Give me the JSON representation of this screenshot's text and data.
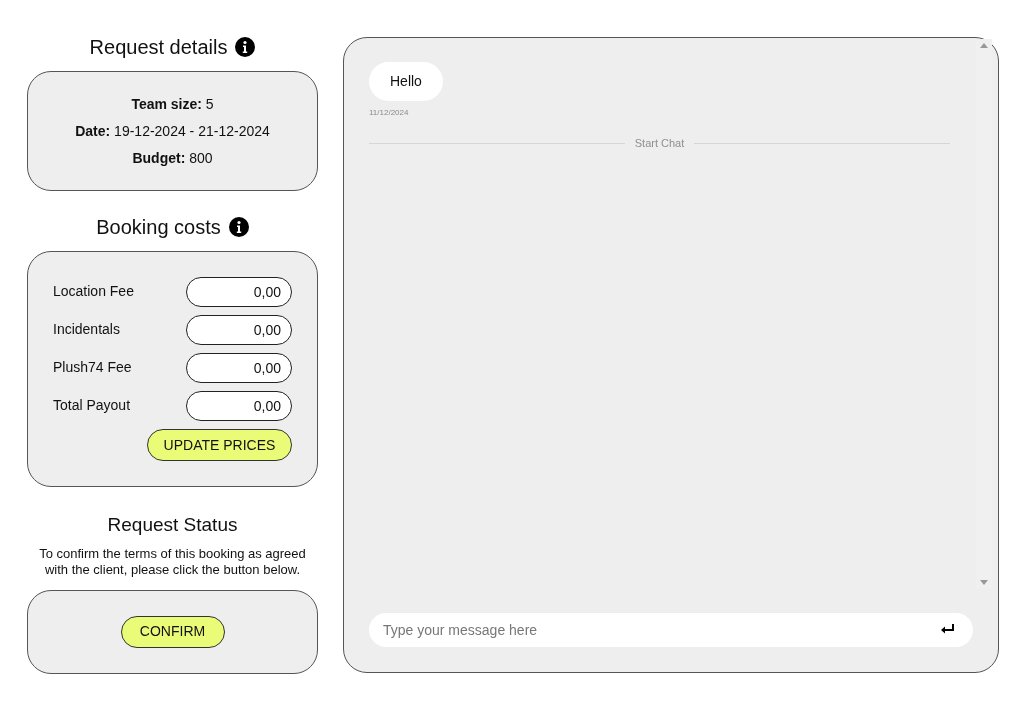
{
  "request_details": {
    "title": "Request details",
    "lines": [
      "**Team size:** 5",
      "**Date:** 19-12-2024 - 21-12-2024",
      "**Budget:** 800"
    ]
  },
  "booking_costs": {
    "title": "Booking costs",
    "fields": [
      {
        "label": "Location Fee",
        "value": "0,00"
      },
      {
        "label": "Incidentals",
        "value": "0,00"
      },
      {
        "label": "Plush74 Fee",
        "value": "0,00"
      },
      {
        "label": "Total Payout",
        "value": "0,00"
      }
    ],
    "button": "UPDATE PRICES"
  },
  "request_status": {
    "title": "Request Status",
    "description": "To confirm the terms of this booking as agreed with the client, please click the button below.",
    "button": "CONFIRM"
  },
  "chat": {
    "messages": [
      {
        "text": "Hello",
        "time": "11/12/2024"
      }
    ],
    "divider": "Start Chat",
    "input": {
      "placeholder": "Type your message here"
    }
  }
}
